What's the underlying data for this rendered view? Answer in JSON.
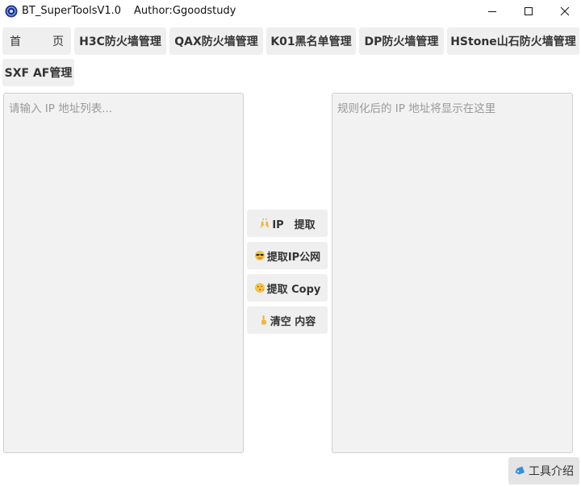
{
  "window": {
    "title": "BT_SuperToolsV1.0",
    "author": "Author:Ggoodstudy"
  },
  "nav": {
    "home_left": "首",
    "home_right": "页",
    "tabs": [
      "H3C防火墙管理",
      "QAX防火墙管理",
      "K01黑名单管理",
      "DP防火墙管理",
      "HStone山石防火墙管理",
      "SXF AF管理"
    ]
  },
  "input_area": {
    "placeholder": "请输入 IP 地址列表..."
  },
  "output_area": {
    "placeholder": "规则化后的 IP 地址将显示在这里"
  },
  "actions": {
    "extract_ip": "IP　提取",
    "extract_public_ip": "提取IP公网",
    "extract_copy": "提取 Copy",
    "clear": "清空 内容"
  },
  "footer": {
    "help_label": "工具介绍"
  },
  "icons": {
    "app": "app-logo-icon",
    "minimize": "minimize-icon",
    "maximize": "maximize-icon",
    "close": "close-icon",
    "extract_ip": "raised-hands-emoji-icon",
    "extract_public_ip": "sunglasses-emoji-icon",
    "extract_copy": "kiss-emoji-icon",
    "clear": "pointing-hand-emoji-icon",
    "help": "tag-icon"
  }
}
